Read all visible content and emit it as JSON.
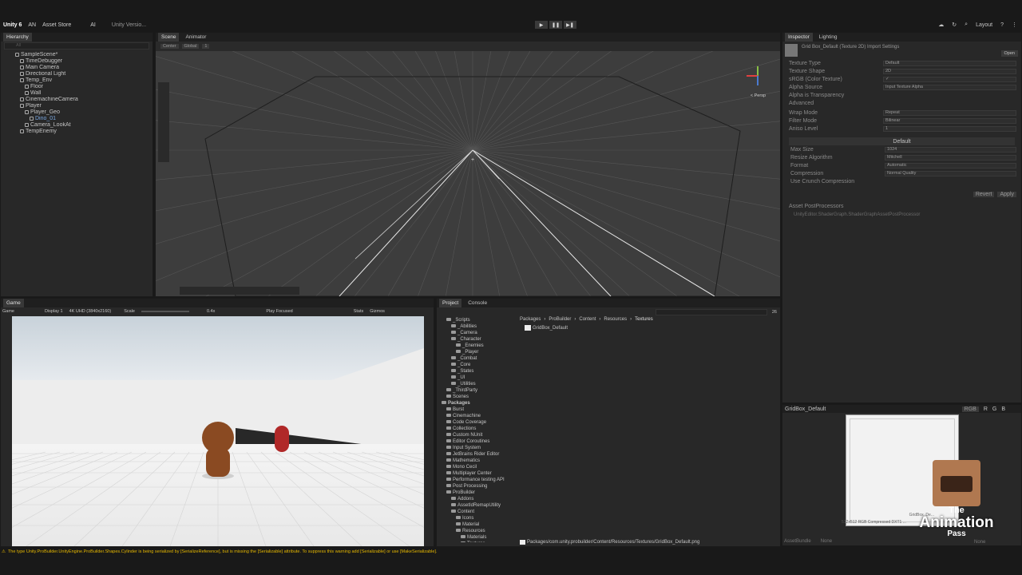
{
  "topbar": {
    "logo": "Unity 6",
    "account": "AN",
    "asset_store": "Asset Store",
    "ai": "AI",
    "version": "Unity Versio...",
    "layout": "Layout"
  },
  "hierarchy": {
    "tab": "Hierarchy",
    "search_placeholder": "All",
    "items": [
      {
        "label": "SampleScene*",
        "indent": 0
      },
      {
        "label": "TimeDebugger",
        "indent": 1
      },
      {
        "label": "Main Camera",
        "indent": 1
      },
      {
        "label": "Directional Light",
        "indent": 1
      },
      {
        "label": "Temp_Env",
        "indent": 1
      },
      {
        "label": "Floor",
        "indent": 2
      },
      {
        "label": "Wall",
        "indent": 2
      },
      {
        "label": "CinemachineCamera",
        "indent": 1
      },
      {
        "label": "Player",
        "indent": 1
      },
      {
        "label": "Player_Geo",
        "indent": 2
      },
      {
        "label": "Dino_01",
        "indent": 3
      },
      {
        "label": "Camera_LookAt",
        "indent": 2
      },
      {
        "label": "TempEnemy",
        "indent": 1
      }
    ]
  },
  "scene": {
    "tabs": [
      "Scene",
      "Animator"
    ],
    "pivot": "Center",
    "space": "Global",
    "grid": "1",
    "persp": "< Persp"
  },
  "inspector": {
    "tabs": [
      "Inspector",
      "Lighting"
    ],
    "title": "Grid Box_Default (Texture 2D) Import Settings",
    "open": "Open",
    "rows": [
      [
        "Texture Type",
        "Default"
      ],
      [
        "Texture Shape",
        "2D"
      ],
      [
        "sRGB (Color Texture)",
        "✓"
      ],
      [
        "Alpha Source",
        "Input Texture Alpha"
      ],
      [
        "Alpha is Transparency",
        ""
      ]
    ],
    "advanced": "Advanced",
    "rows2": [
      [
        "Wrap Mode",
        "Repeat"
      ],
      [
        "Filter Mode",
        "Bilinear"
      ],
      [
        "Aniso Level",
        "1"
      ]
    ],
    "platform": "Default",
    "rows3": [
      [
        "Max Size",
        "1024"
      ],
      [
        "Resize Algorithm",
        "Mitchell"
      ],
      [
        "Format",
        "Automatic"
      ],
      [
        "Compression",
        "Normal Quality"
      ],
      [
        "Use Crunch Compression",
        ""
      ]
    ],
    "revert": "Revert",
    "apply": "Apply",
    "post_title": "Asset PostProcessors",
    "post_item": "UnityEditor.ShaderGraph.ShaderGraphAssetPostProcessor",
    "preview_title": "GridBox_Default",
    "preview_channels": [
      "RGB",
      "R",
      "G",
      "B"
    ],
    "preview_caption": "GridBox_De...",
    "preview_info": "512x512 RGB Compressed DXT1 ...",
    "assetbundle": "AssetBundle",
    "assetbundle_value": "None",
    "assetbundle_variant": "None"
  },
  "game": {
    "tab": "Game",
    "mode": "Game",
    "display": "Display 1",
    "resolution": "4K UHD (3840x2160)",
    "scale_label": "Scale",
    "scale_value": "0.4x",
    "play_mode": "Play Focused",
    "stats": "Stats",
    "gizmos": "Gizmos"
  },
  "project": {
    "tabs": [
      "Project",
      "Console"
    ],
    "count": "26",
    "tree": [
      {
        "label": "_Scripts",
        "indent": 1
      },
      {
        "label": "_Abilities",
        "indent": 2
      },
      {
        "label": "_Camera",
        "indent": 2
      },
      {
        "label": "_Character",
        "indent": 2
      },
      {
        "label": "_Enemies",
        "indent": 3
      },
      {
        "label": "_Player",
        "indent": 3
      },
      {
        "label": "_Combat",
        "indent": 2
      },
      {
        "label": "_Core",
        "indent": 2
      },
      {
        "label": "_States",
        "indent": 2
      },
      {
        "label": "_UI",
        "indent": 2
      },
      {
        "label": "_Utilities",
        "indent": 2
      },
      {
        "label": "_ThirdParty",
        "indent": 1
      },
      {
        "label": "Scenes",
        "indent": 1
      },
      {
        "label": "Packages",
        "indent": 0
      },
      {
        "label": "Burst",
        "indent": 1
      },
      {
        "label": "Cinemachine",
        "indent": 1
      },
      {
        "label": "Code Coverage",
        "indent": 1
      },
      {
        "label": "Collections",
        "indent": 1
      },
      {
        "label": "Custom NUnit",
        "indent": 1
      },
      {
        "label": "Editor Coroutines",
        "indent": 1
      },
      {
        "label": "Input System",
        "indent": 1
      },
      {
        "label": "JetBrains Rider Editor",
        "indent": 1
      },
      {
        "label": "Mathematics",
        "indent": 1
      },
      {
        "label": "Mono Cecil",
        "indent": 1
      },
      {
        "label": "Multiplayer Center",
        "indent": 1
      },
      {
        "label": "Performance testing API",
        "indent": 1
      },
      {
        "label": "Post Processing",
        "indent": 1
      },
      {
        "label": "ProBuilder",
        "indent": 1
      },
      {
        "label": "Addons",
        "indent": 2
      },
      {
        "label": "AssetIdRemapUtility",
        "indent": 2
      },
      {
        "label": "Content",
        "indent": 2
      },
      {
        "label": "Icons",
        "indent": 3
      },
      {
        "label": "Material",
        "indent": 3
      },
      {
        "label": "Resources",
        "indent": 3
      },
      {
        "label": "Materials",
        "indent": 4
      },
      {
        "label": "Textures",
        "indent": 4
      }
    ],
    "breadcrumb": [
      "Packages",
      "ProBuilder",
      "Content",
      "Resources",
      "Textures"
    ],
    "asset": "GridBox_Default",
    "path": "Packages/com.unity.probuilder/Content/Resources/Textures/GridBox_Default.png"
  },
  "status": {
    "warning": "The type Unity.ProBuilder.UnityEngine.ProBuilder.Shapes.Cylinder is being serialized by [SerializeReference], but is missing the [Serializable] attribute. To suppress this warning add [Serializable] or use [MakeSerializable]."
  },
  "watermark": {
    "line1": "The",
    "line2": "Animation",
    "line3": "Pass"
  },
  "colors": {
    "accent": "#3d6fb0",
    "warning": "#e6b800"
  }
}
